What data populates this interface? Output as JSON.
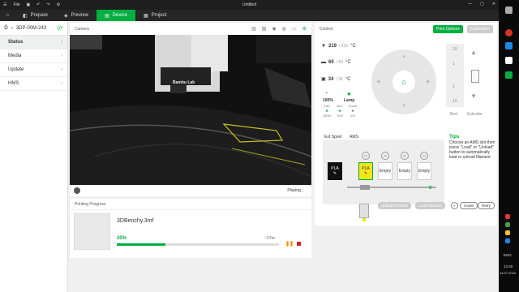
{
  "window": {
    "title": "Untitled",
    "menu_file": "File"
  },
  "tabs": [
    {
      "label": "Prepare"
    },
    {
      "label": "Preview"
    },
    {
      "label": "Device"
    },
    {
      "label": "Project"
    }
  ],
  "sidebar": {
    "device_name": "3DP-00M-243",
    "items": [
      {
        "label": "Status"
      },
      {
        "label": "Media"
      },
      {
        "label": "Update"
      },
      {
        "label": "HMS"
      }
    ]
  },
  "camera": {
    "title": "Camera",
    "status": "Playing...",
    "brand_text": "Bambu Lab"
  },
  "progress": {
    "title": "Printing Progress",
    "file_name": "3DBenchy.3mf",
    "percent_text": "30%",
    "percent": 0.3,
    "remaining": "~17m"
  },
  "control": {
    "title": "Control",
    "print_options": "Print Options",
    "calibration": "Calibration",
    "nozzle": {
      "value": "219",
      "target": "/ 220",
      "unit": "°C"
    },
    "bed": {
      "value": "60",
      "target": "/ 60",
      "unit": "°C"
    },
    "chamber": {
      "value": "34",
      "target": "/ 36",
      "unit": "°C"
    },
    "speed": "100%",
    "lamp": "Lamp",
    "fans": [
      {
        "label": "Part",
        "value": "100%"
      },
      {
        "label": "Aux",
        "value": "70%"
      },
      {
        "label": "Cham",
        "value": "0%"
      }
    ],
    "z_labels": [
      "10",
      "1",
      "1",
      "10"
    ],
    "bed_label": "Bed",
    "extruder_label": "Extruder",
    "ext_spool": "Ext Spool",
    "ams": "AMS",
    "ext_slot": "PLA",
    "slots": [
      {
        "cap": "A1",
        "label": "PLA",
        "color": "#f5e51b"
      },
      {
        "cap": "A2",
        "label": "Empty",
        "color": "#ffffff"
      },
      {
        "cap": "A3",
        "label": "Empty",
        "color": "#ffffff"
      },
      {
        "cap": "A4",
        "label": "Empty",
        "color": "#ffffff"
      }
    ],
    "tips_title": "Tips",
    "tips_body": "Choose an AMS slot then press \"Load\" or \"Unload\" button to automatically load or unload filament",
    "unload": "Unload Filament",
    "load": "Load Filament",
    "guide": "Guide",
    "retry": "Retry"
  },
  "taskbar": {
    "lang": "ENG",
    "time": "14:40",
    "date": "14.07.2023"
  },
  "colors": {
    "accent": "#00ae42"
  }
}
